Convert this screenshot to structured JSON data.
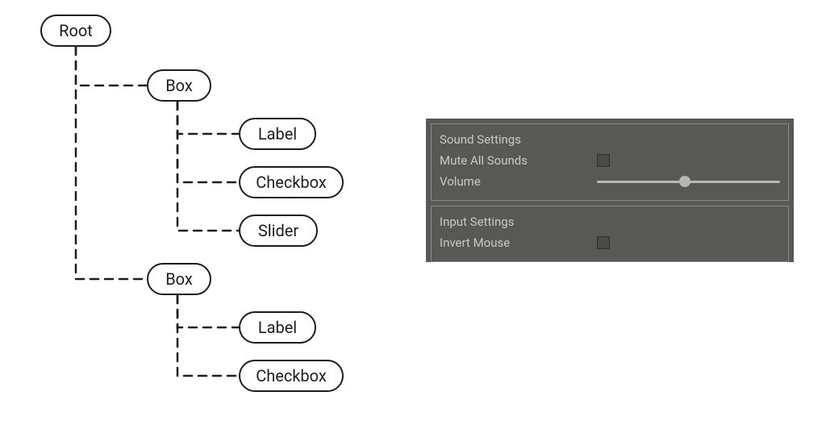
{
  "tree": {
    "root": {
      "label": "Root"
    },
    "box1": {
      "label": "Box"
    },
    "label1": {
      "label": "Label"
    },
    "check1": {
      "label": "Checkbox"
    },
    "slider1": {
      "label": "Slider"
    },
    "box2": {
      "label": "Box"
    },
    "label2": {
      "label": "Label"
    },
    "check2": {
      "label": "Checkbox"
    }
  },
  "panel": {
    "sound": {
      "title": "Sound Settings",
      "muteLabel": "Mute All Sounds",
      "muteChecked": false,
      "volumeLabel": "Volume",
      "volumePercent": 48
    },
    "input": {
      "title": "Input Settings",
      "invertLabel": "Invert Mouse",
      "invertChecked": false
    }
  }
}
